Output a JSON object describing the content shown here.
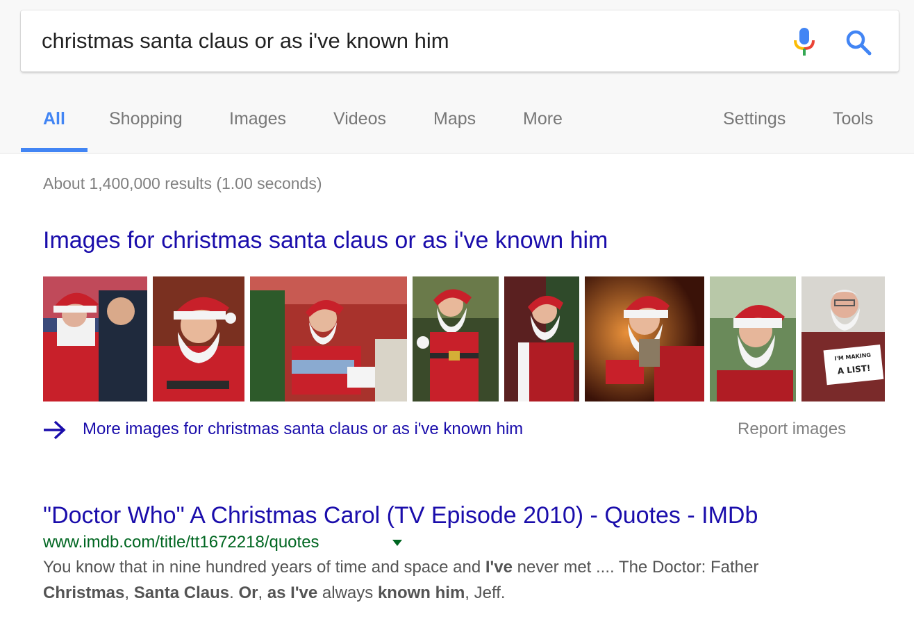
{
  "search": {
    "query": "christmas santa claus or as i've known him",
    "mic_icon": "microphone-icon",
    "search_icon": "magnifier-icon"
  },
  "tabs": [
    {
      "label": "All",
      "active": true
    },
    {
      "label": "Shopping"
    },
    {
      "label": "Images"
    },
    {
      "label": "Videos"
    },
    {
      "label": "Maps"
    },
    {
      "label": "More"
    },
    {
      "label": "Settings"
    },
    {
      "label": "Tools"
    }
  ],
  "result_stats": "About 1,400,000 results (1.00 seconds)",
  "images_section": {
    "heading": "Images for christmas santa claus or as i've known him",
    "more_link": "More images for christmas santa claus or as i've known him",
    "report_link": "Report images",
    "sign_text": [
      "I'M MAKING",
      "A LIST!"
    ]
  },
  "result": {
    "title": "\"Doctor Who\" A Christmas Carol (TV Episode 2010) - Quotes - IMDb",
    "url": "www.imdb.com/title/tt1672218/quotes",
    "snippet_line1": [
      {
        "t": "You know that in nine hundred years of time and space and ",
        "b": false
      },
      {
        "t": "I've",
        "b": true
      },
      {
        "t": " never met .... The Doctor: Father",
        "b": false
      }
    ],
    "snippet_line2": [
      {
        "t": "Christmas",
        "b": true
      },
      {
        "t": ", ",
        "b": false
      },
      {
        "t": "Santa Claus",
        "b": true
      },
      {
        "t": ". ",
        "b": false
      },
      {
        "t": "Or",
        "b": true
      },
      {
        "t": ", ",
        "b": false
      },
      {
        "t": "as I've",
        "b": true
      },
      {
        "t": " always ",
        "b": false
      },
      {
        "t": "known him",
        "b": true
      },
      {
        "t": ", Jeff.",
        "b": false
      }
    ]
  },
  "colors": {
    "link": "#1a0dab",
    "url": "#006621",
    "tab_active": "#4285f4",
    "muted": "#808080",
    "santa_red": "#c8202a"
  }
}
